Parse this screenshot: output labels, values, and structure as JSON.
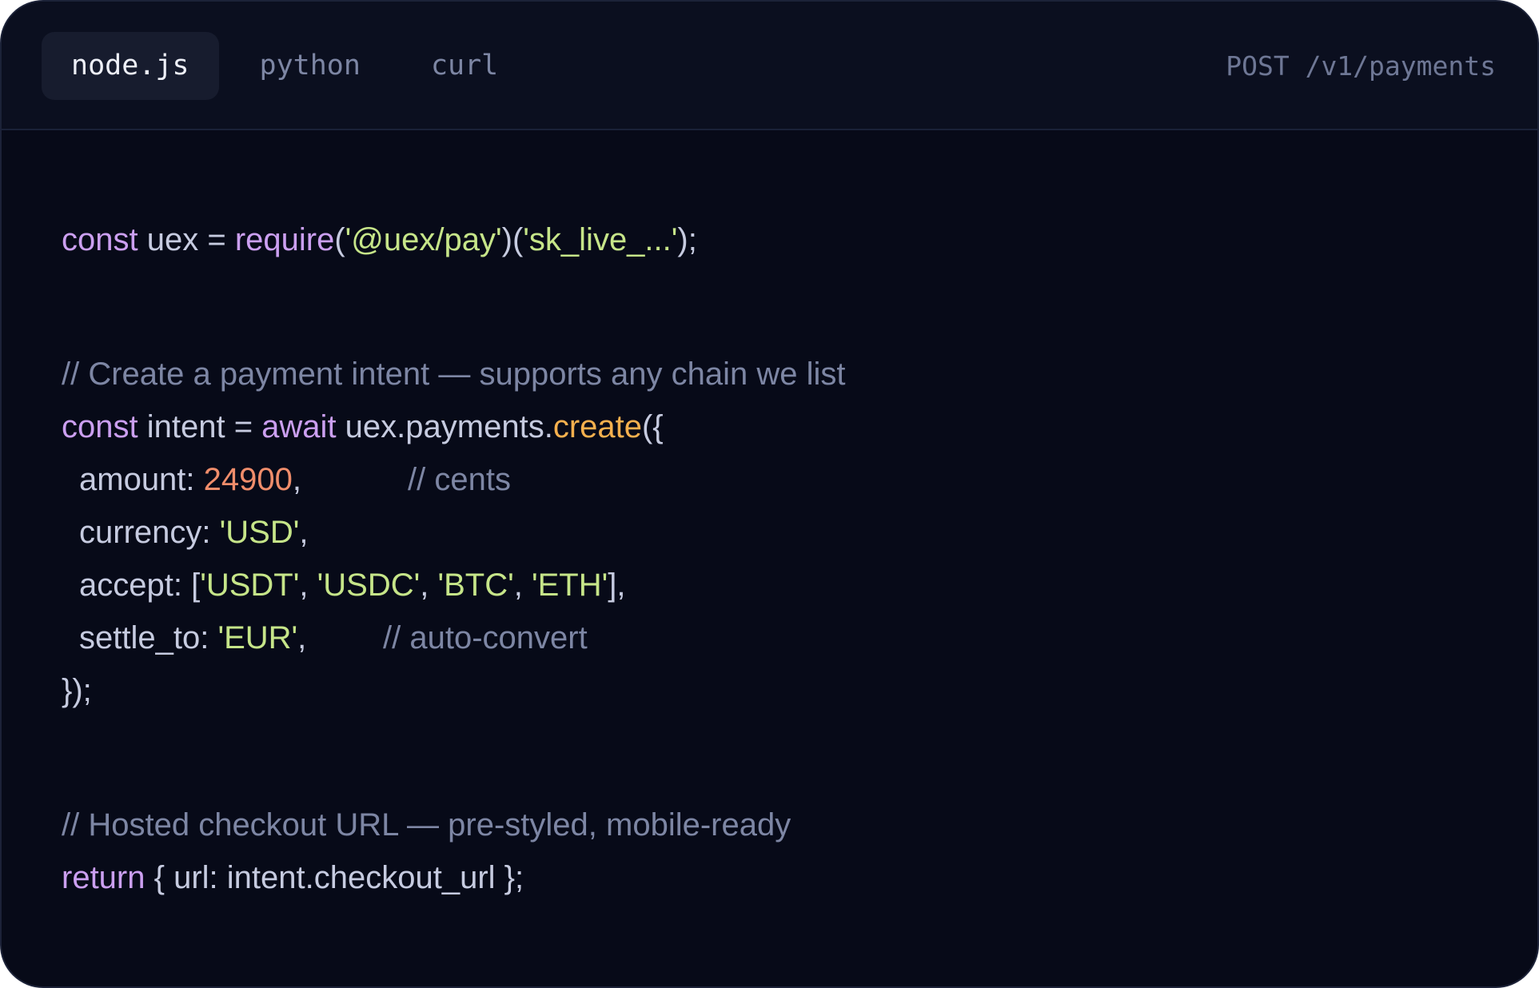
{
  "tabs": [
    {
      "label": "node.js",
      "active": true
    },
    {
      "label": "python",
      "active": false
    },
    {
      "label": "curl",
      "active": false
    }
  ],
  "endpoint": "POST /v1/payments",
  "code": {
    "l1": {
      "kw": "const",
      "id": " uex = ",
      "fn": "require",
      "p1": "(",
      "s1": "'@uex/pay'",
      "p2": ")(",
      "s2": "'sk_live_...'",
      "p3": ");"
    },
    "l2": {
      "comment": "// Create a payment intent — supports any chain we list"
    },
    "l3": {
      "kw1": "const",
      "id1": " intent = ",
      "kw2": "await",
      "id2": " uex.payments.",
      "fn": "create",
      "p": "({"
    },
    "l4": {
      "key": "amount: ",
      "num": "24900",
      "p": ",",
      "comment": "// cents"
    },
    "l5": {
      "key": "currency: ",
      "s1": "'USD'",
      "p": ","
    },
    "l6": {
      "key": "accept: [",
      "s1": "'USDT'",
      "c1": ", ",
      "s2": "'USDC'",
      "c2": ", ",
      "s3": "'BTC'",
      "c3": ", ",
      "s4": "'ETH'",
      "p": "],"
    },
    "l7": {
      "key": "settle_to: ",
      "s1": "'EUR'",
      "p": ",",
      "comment": "// auto-convert"
    },
    "l8": {
      "p": "});"
    },
    "l9": {
      "comment": "// Hosted checkout URL — pre-styled, mobile-ready"
    },
    "l10": {
      "kw": "return",
      "rest": " { url: intent.checkout_url };"
    }
  },
  "colors": {
    "background": "#070a18",
    "keyword": "#cb9ff0",
    "string": "#c6e589",
    "number": "#f08d6b",
    "function": "#f5b04e",
    "comment": "#7d86a4",
    "text": "#c6cbe0"
  }
}
